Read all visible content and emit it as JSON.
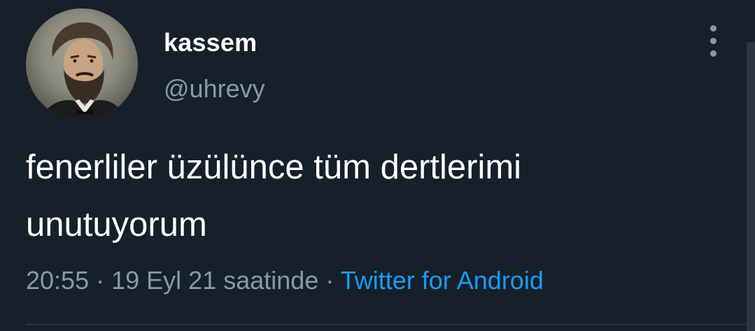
{
  "tweet": {
    "author": {
      "display_name": "kassem",
      "handle": "@uhrevy",
      "avatar_icon": "portrait-avatar"
    },
    "text_line1": "fenerliler üzülünce tüm dertlerimi",
    "text_line2": "unutuyorum",
    "time": "20:55",
    "separator": "·",
    "date": "19 Eyl 21 saatinde",
    "source": "Twitter for Android",
    "more_icon": "more-vertical-icon"
  },
  "colors": {
    "background": "#15202b",
    "primary_text": "#ffffff",
    "secondary_text": "#8b98a5",
    "link": "#1d9bf0",
    "divider": "#38444d"
  }
}
